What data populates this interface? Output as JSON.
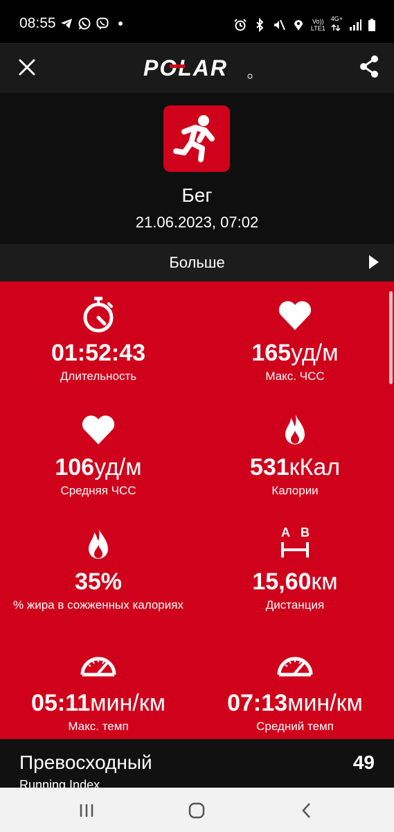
{
  "status": {
    "time": "08:55",
    "left_icons": [
      "telegram-icon",
      "whatsapp-icon",
      "viber-icon",
      "dot-icon"
    ],
    "right_icons": [
      "alarm-icon",
      "bluetooth-icon",
      "mute-icon",
      "location-icon",
      "volte-icon",
      "4g-icon",
      "signal-icon",
      "battery-icon"
    ],
    "volte_top": "Vo))",
    "volte_bottom": "LTE1",
    "net_top": "4G+"
  },
  "header": {
    "logo_text": "POLAR",
    "close_icon": "close-icon",
    "share_icon": "share-icon"
  },
  "activity": {
    "sport": "Бег",
    "date": "21.06.2023, 07:02",
    "more_label": "Больше"
  },
  "stats": [
    {
      "value": "01:52:43",
      "unit": "",
      "label": "Длительность",
      "icon": "stopwatch-icon"
    },
    {
      "value": "165",
      "unit": "уд/м",
      "label": "Макс. ЧСС",
      "icon": "heart-icon"
    },
    {
      "value": "106",
      "unit": "уд/м",
      "label": "Средняя ЧСС",
      "icon": "heart-icon"
    },
    {
      "value": "531",
      "unit": "кКал",
      "label": "Калории",
      "icon": "flame-icon"
    },
    {
      "value": "35%",
      "unit": "",
      "label": "% жира в сожженных калориях",
      "icon": "flame-icon"
    },
    {
      "value": "15,60",
      "unit": "км",
      "label": "Дистанция",
      "icon": "distance-icon"
    },
    {
      "value": "05:11",
      "unit": "мин/км",
      "label": "Макс. темп",
      "icon": "speedometer-icon"
    },
    {
      "value": "07:13",
      "unit": "мин/км",
      "label": "Средний темп",
      "icon": "speedometer-icon"
    }
  ],
  "distance_icon_letters": {
    "a": "A",
    "b": "B"
  },
  "running_index": {
    "title": "Превосходный",
    "subtitle": "Running Index",
    "value": "49"
  },
  "colors": {
    "accent": "#d0021b",
    "header_bg": "#1a1a1a",
    "nav_bg": "#f2f2f2"
  },
  "nav": [
    "recents-icon",
    "home-icon",
    "back-icon"
  ]
}
